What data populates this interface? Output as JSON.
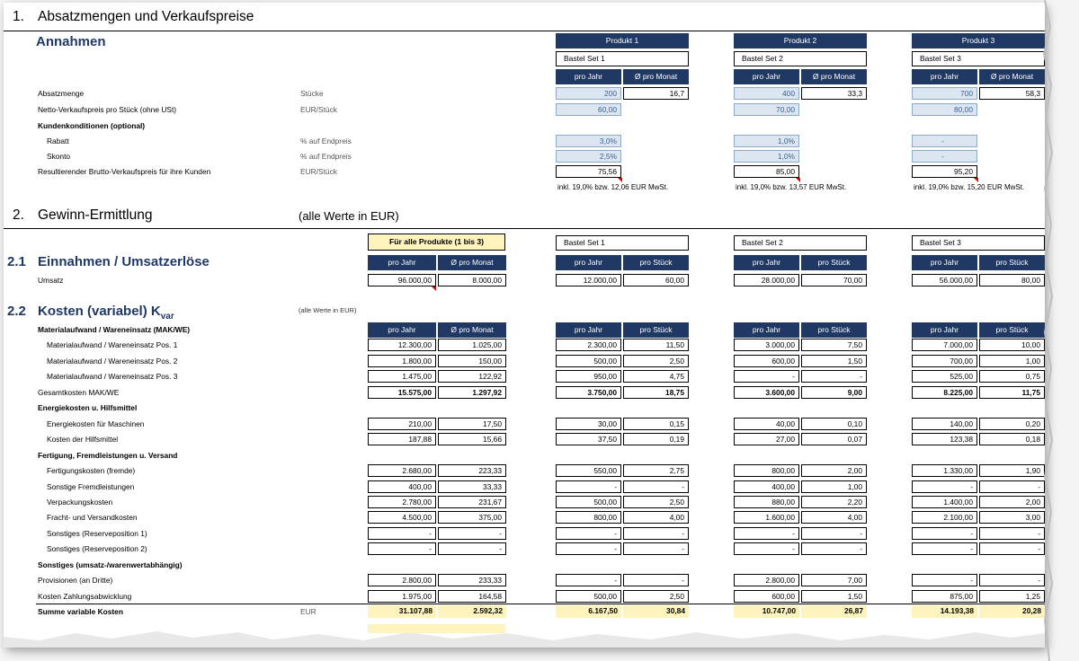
{
  "section1": {
    "number": "1.",
    "title": "Absatzmengen und Verkaufspreise",
    "annahmen": "Annahmen",
    "products": [
      {
        "header": "Produkt 1",
        "name": "Bastel Set 1"
      },
      {
        "header": "Produkt 2",
        "name": "Bastel Set 2"
      },
      {
        "header": "Produkt 3",
        "name": "Bastel Set 3"
      }
    ],
    "col_headers": [
      "pro Jahr",
      "Ø pro Monat"
    ],
    "rows": {
      "absatz": {
        "label": "Absatzmenge",
        "unit": "Stücke",
        "values": [
          [
            "200",
            "16,7"
          ],
          [
            "400",
            "33,3"
          ],
          [
            "700",
            "58,3"
          ]
        ]
      },
      "netto": {
        "label": "Netto-Verkaufspreis pro Stück (ohne USt)",
        "unit": "EUR/Stück",
        "values": [
          "60,00",
          "70,00",
          "80,00"
        ]
      },
      "kunden": {
        "label": "Kundenkonditionen (optional)"
      },
      "rabatt": {
        "label": "Rabatt",
        "unit": "% auf Endpreis",
        "values": [
          "3,0%",
          "1,0%",
          "-"
        ]
      },
      "skonto": {
        "label": "Skonto",
        "unit": "% auf Endpreis",
        "values": [
          "2,5%",
          "1,0%",
          "-"
        ]
      },
      "brutto": {
        "label": "Resultierender Brutto-Verkaufspreis für ihre Kunden",
        "unit": "EUR/Stück",
        "values": [
          "75,56",
          "85,00",
          "95,20"
        ]
      }
    },
    "mwst_notes": [
      "inkl. 19,0% bzw. 12,06 EUR MwSt.",
      "inkl. 19,0% bzw. 13,57 EUR MwSt.",
      "inkl. 19,0% bzw. 15,20 EUR MwSt."
    ]
  },
  "section2": {
    "number": "2.",
    "title": "Gewinn-Ermittlung",
    "note": "(alle Werte in EUR)",
    "all_products_header": "Für alle Produkte (1 bis 3)",
    "product_names": [
      "Bastel Set 1",
      "Bastel Set 2",
      "Bastel Set 3"
    ],
    "col_headers_all": [
      "pro Jahr",
      "Ø pro Monat"
    ],
    "col_headers_prod": [
      "pro Jahr",
      "pro Stück"
    ]
  },
  "section21": {
    "number": "2.1",
    "title": "Einnahmen / Umsatzerlöse",
    "umsatz": {
      "label": "Umsatz",
      "values": [
        "96.000,00",
        "8.000,00",
        "12.000,00",
        "60,00",
        "28.000,00",
        "70,00",
        "56.000,00",
        "80,00"
      ]
    }
  },
  "section22": {
    "number": "2.2",
    "title": "Kosten (variabel) K",
    "title_sub": "var",
    "note": "(alle Werte in EUR)",
    "rows": [
      {
        "label": "Materialaufwand / Wareneinsatz (MAK/WE)",
        "type": "header"
      },
      {
        "label": "Materialaufwand / Wareneinsatz Pos. 1",
        "type": "data",
        "values": [
          "12.300,00",
          "1.025,00",
          "2.300,00",
          "11,50",
          "3.000,00",
          "7,50",
          "7.000,00",
          "10,00"
        ]
      },
      {
        "label": "Materialaufwand / Wareneinsatz Pos. 2",
        "type": "data",
        "values": [
          "1.800,00",
          "150,00",
          "500,00",
          "2,50",
          "600,00",
          "1,50",
          "700,00",
          "1,00"
        ]
      },
      {
        "label": "Materialaufwand / Wareneinsatz Pos. 3",
        "type": "data",
        "values": [
          "1.475,00",
          "122,92",
          "950,00",
          "4,75",
          "-",
          "-",
          "525,00",
          "0,75"
        ]
      },
      {
        "label": "Gesamtkosten MAK/WE",
        "type": "sum",
        "values": [
          "15.575,00",
          "1.297,92",
          "3.750,00",
          "18,75",
          "3.600,00",
          "9,00",
          "8.225,00",
          "11,75"
        ]
      },
      {
        "label": "Energiekosten u. Hilfsmittel",
        "type": "group"
      },
      {
        "label": "Energiekosten für Maschinen",
        "type": "data",
        "values": [
          "210,00",
          "17,50",
          "30,00",
          "0,15",
          "40,00",
          "0,10",
          "140,00",
          "0,20"
        ]
      },
      {
        "label": "Kosten der Hilfsmittel",
        "type": "data",
        "values": [
          "187,88",
          "15,66",
          "37,50",
          "0,19",
          "27,00",
          "0,07",
          "123,38",
          "0,18"
        ]
      },
      {
        "label": "Fertigung, Fremdleistungen u. Versand",
        "type": "group"
      },
      {
        "label": "Fertigungskosten (fremde)",
        "type": "data",
        "values": [
          "2.680,00",
          "223,33",
          "550,00",
          "2,75",
          "800,00",
          "2,00",
          "1.330,00",
          "1,90"
        ]
      },
      {
        "label": "Sonstige Fremdleistungen",
        "type": "data",
        "values": [
          "400,00",
          "33,33",
          "-",
          "-",
          "400,00",
          "1,00",
          "-",
          "-"
        ]
      },
      {
        "label": "Verpackungskosten",
        "type": "data",
        "values": [
          "2.780,00",
          "231,67",
          "500,00",
          "2,50",
          "880,00",
          "2,20",
          "1.400,00",
          "2,00"
        ]
      },
      {
        "label": "Fracht- und Versandkosten",
        "type": "data",
        "values": [
          "4.500,00",
          "375,00",
          "800,00",
          "4,00",
          "1.600,00",
          "4,00",
          "2.100,00",
          "3,00"
        ]
      },
      {
        "label": "Sonstiges (Reserveposition 1)",
        "type": "data",
        "values": [
          "-",
          "-",
          "-",
          "-",
          "-",
          "-",
          "-",
          "-"
        ]
      },
      {
        "label": "Sonstiges (Reserveposition 2)",
        "type": "data",
        "values": [
          "-",
          "-",
          "-",
          "-",
          "-",
          "-",
          "-",
          "-"
        ]
      },
      {
        "label": "Sonstiges (umsatz-/warenwertabhängig)",
        "type": "group"
      },
      {
        "label": "Provisionen (an Dritte)",
        "type": "data-flat",
        "values": [
          "2.800,00",
          "233,33",
          "-",
          "-",
          "2.800,00",
          "7,00",
          "-",
          "-"
        ]
      },
      {
        "label": "Kosten Zahlungsabwicklung",
        "type": "data-flat",
        "values": [
          "1.975,00",
          "164,58",
          "500,00",
          "2,50",
          "600,00",
          "1,50",
          "875,00",
          "1,25"
        ]
      },
      {
        "label": "Summe variable Kosten",
        "type": "total",
        "unit": "EUR",
        "values": [
          "31.107,88",
          "2.592,32",
          "6.167,50",
          "30,84",
          "10.747,00",
          "26,87",
          "14.193,38",
          "20,28"
        ]
      }
    ]
  },
  "colors": {
    "header_navy": "#1f3864",
    "input_fill": "#dce6f1",
    "input_text": "#355f91",
    "highlight_yellow": "#fdf3bc",
    "comment_marker": "#e00000"
  }
}
